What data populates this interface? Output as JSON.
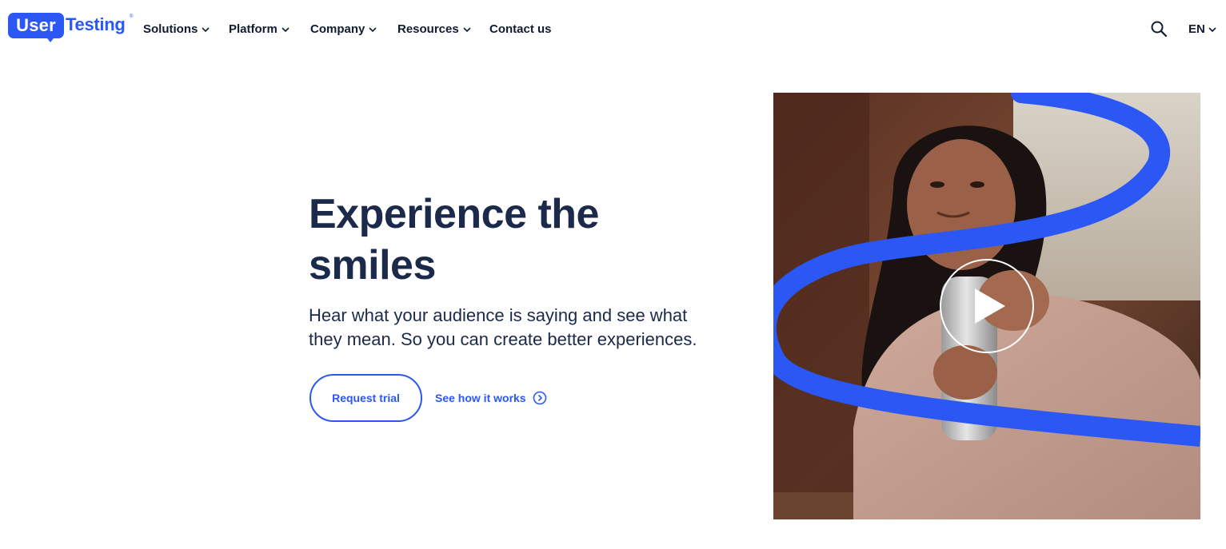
{
  "brand": {
    "logo_user": "User",
    "logo_testing": "Testing",
    "logo_reg": "®",
    "primary_color": "#2b57f5",
    "text_color": "#1b2a4a"
  },
  "nav": {
    "items": [
      {
        "label": "Solutions",
        "icon": "chevron-down-icon"
      },
      {
        "label": "Platform",
        "icon": "chevron-down-icon"
      },
      {
        "label": "Company",
        "icon": "chevron-down-icon"
      },
      {
        "label": "Resources",
        "icon": "chevron-down-icon"
      },
      {
        "label": "Contact us"
      }
    ],
    "search_icon": "search-icon",
    "language": "EN"
  },
  "hero": {
    "title_line1": "Experience the",
    "title_line2": "smiles",
    "subtitle_line1": "Hear what your audience is saying and see what",
    "subtitle_line2": "they mean. So you can create better experiences.",
    "cta_primary": "Request trial",
    "cta_secondary": "See how it works",
    "cta_secondary_icon": "chevron-circle-right-icon",
    "media_icon": "play-icon"
  }
}
